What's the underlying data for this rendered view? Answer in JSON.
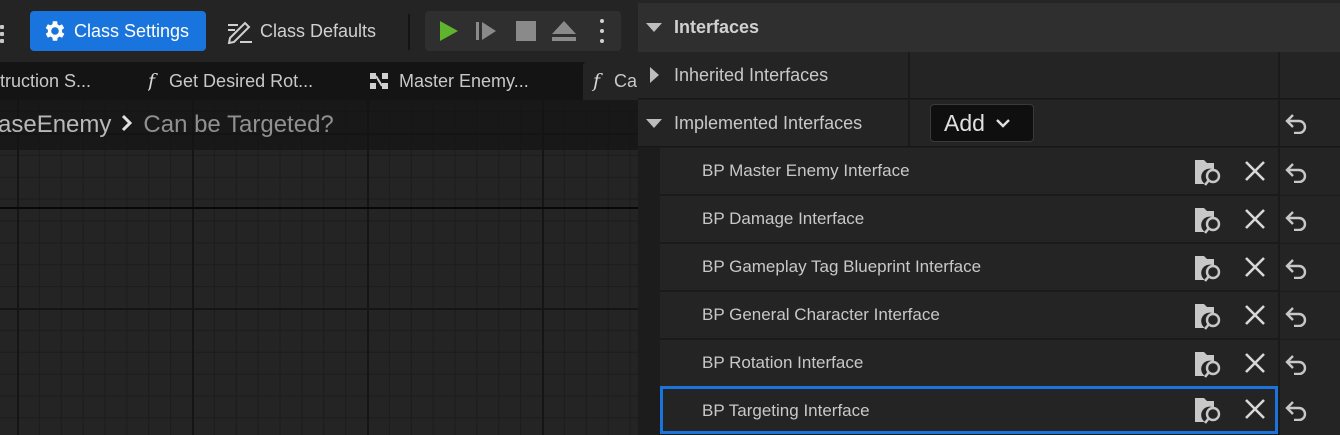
{
  "toolbar": {
    "class_settings_label": "Class Settings",
    "class_defaults_label": "Class Defaults",
    "accent_color": "#1a74de",
    "play_color": "#5fb32d"
  },
  "tabs": [
    {
      "label": "truction S..."
    },
    {
      "label": "Get Desired Rot..."
    },
    {
      "label": "Master Enemy..."
    },
    {
      "label": "Ca"
    }
  ],
  "breadcrumb": {
    "parent": "aseEnemy",
    "separator": ">",
    "current": "Can be Targeted?"
  },
  "details": {
    "section_title": "Interfaces",
    "inherited_label": "Inherited Interfaces",
    "implemented_label": "Implemented Interfaces",
    "add_label": "Add",
    "items": [
      {
        "label": "BP Master Enemy Interface"
      },
      {
        "label": "BP Damage Interface"
      },
      {
        "label": "BP Gameplay Tag Blueprint Interface"
      },
      {
        "label": "BP General Character Interface"
      },
      {
        "label": "BP Rotation Interface"
      },
      {
        "label": "BP Targeting Interface",
        "selected": true
      }
    ]
  }
}
